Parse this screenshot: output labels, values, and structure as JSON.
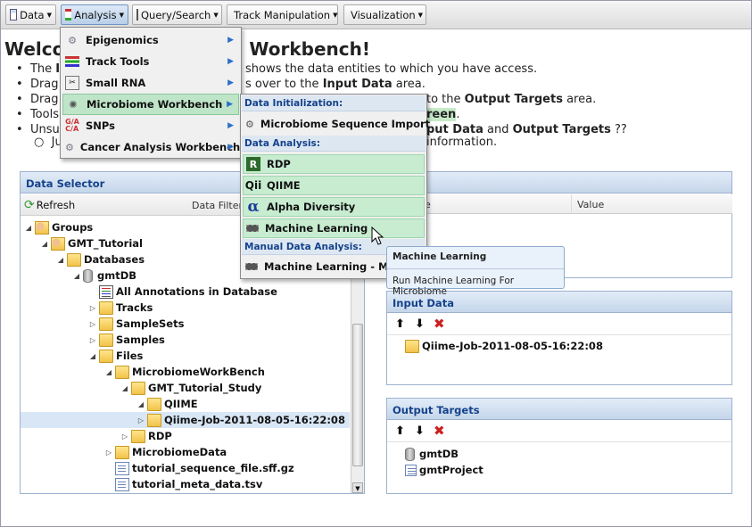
{
  "toolbar": {
    "data": "Data",
    "analysis": "Analysis",
    "query": "Query/Search",
    "track": "Track Manipulation",
    "visualization": "Visualization"
  },
  "welcome": {
    "title_start": "Welco",
    "title_end": "Workbench!",
    "line1_a": "The",
    "line1_b": "shows the data entities to which you have access.",
    "line2_a": "Drag",
    "line2_b": "s over to the",
    "line2_c": "Input Data",
    "line2_d": "area.",
    "line3_a": "Drag",
    "line3_b": "to the",
    "line3_c": "Output Targets",
    "line3_d": "area.",
    "line4_a": "Tools",
    "line4_b": "reen",
    "line4_c": ".",
    "line5_a": "Unsu",
    "line5_b": "put Data",
    "line5_c": "and",
    "line5_d": "Output Targets",
    "line5_e": "??",
    "line6_a": "Ju",
    "line6_b": "information."
  },
  "data_selector": {
    "title": "Data Selector",
    "refresh": "Refresh",
    "filter": "Data Filter:",
    "tree": [
      {
        "label": "Groups"
      },
      {
        "label": "GMT_Tutorial"
      },
      {
        "label": "Databases"
      },
      {
        "label": "gmtDB"
      },
      {
        "label": "All Annotations in Database"
      },
      {
        "label": "Tracks"
      },
      {
        "label": "SampleSets"
      },
      {
        "label": "Samples"
      },
      {
        "label": "Files"
      },
      {
        "label": "MicrobiomeWorkBench"
      },
      {
        "label": "GMT_Tutorial_Study"
      },
      {
        "label": "QIIME"
      },
      {
        "label": "Qiime-Job-2011-08-05-16:22:08"
      },
      {
        "label": "RDP"
      },
      {
        "label": "MicrobiomeData"
      },
      {
        "label": "tutorial_sequence_file.sff.gz"
      },
      {
        "label": "tutorial_meta_data.tsv"
      }
    ]
  },
  "details": {
    "col1": "e",
    "col2": "Value"
  },
  "input_data": {
    "title": "Input Data",
    "item": "Qiime-Job-2011-08-05-16:22:08"
  },
  "output_targets": {
    "title": "Output Targets",
    "items": [
      "gmtDB",
      "gmtProject"
    ]
  },
  "analysis_menu": [
    {
      "label": "Epigenomics"
    },
    {
      "label": "Track Tools"
    },
    {
      "label": "Small RNA"
    },
    {
      "label": "Microbiome Workbench"
    },
    {
      "label": "SNPs"
    },
    {
      "label": "Cancer Analysis Workbench"
    }
  ],
  "microbiome_menu": {
    "sec1": "Data Initialization:",
    "import": "Microbiome Sequence Import",
    "sec2": "Data Analysis:",
    "rdp": "RDP",
    "qiime": "QIIME",
    "alpha": "Alpha Diversity",
    "ml": "Machine Learning",
    "sec3": "Manual Data Analysis:",
    "ml_manual": "Machine Learning - Manua"
  },
  "tooltip": {
    "title": "Machine Learning",
    "body": "Run Machine Learning For Microbiome"
  },
  "colors": {
    "accent": "#15428b",
    "menu_hover": "#bfe5c8",
    "highlight": "#c6eac8"
  }
}
